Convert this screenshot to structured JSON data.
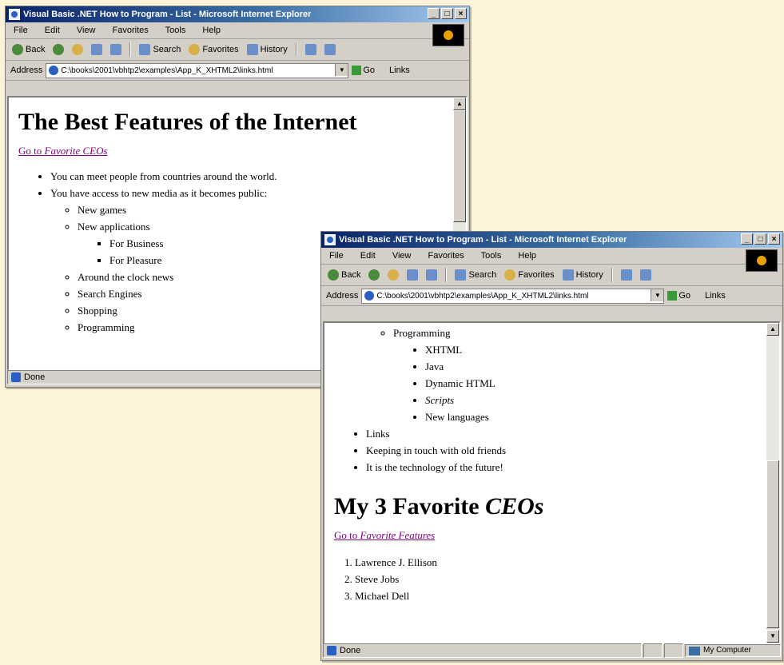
{
  "window1": {
    "title": "Visual Basic .NET How to Program - List - Microsoft Internet Explorer",
    "caption_buttons": [
      "_",
      "□",
      "×"
    ],
    "menu": [
      "File",
      "Edit",
      "View",
      "Favorites",
      "Tools",
      "Help"
    ],
    "toolbar": {
      "back": "Back",
      "search": "Search",
      "favorites": "Favorites",
      "history": "History"
    },
    "address_label": "Address",
    "address_value": "C:\\books\\2001\\vbhtp2\\examples\\App_K_XHTML2\\links.html",
    "go_label": "Go",
    "links_label": "Links",
    "status": "Done",
    "page": {
      "heading": "The Best Features of the Internet",
      "link_prefix": "Go to ",
      "link_em": "Favorite CEOs",
      "items": [
        "You can meet people from countries around the world.",
        "You have access to new media as it becomes public:"
      ],
      "sub_items": [
        "New games",
        "New applications"
      ],
      "sub_sub_items": [
        "For Business",
        "For Pleasure"
      ],
      "sub_items_after": [
        "Around the clock news",
        "Search Engines",
        "Shopping",
        "Programming"
      ]
    }
  },
  "window2": {
    "title": "Visual Basic .NET How to Program - List - Microsoft Internet Explorer",
    "caption_buttons": [
      "_",
      "□",
      "×"
    ],
    "menu": [
      "File",
      "Edit",
      "View",
      "Favorites",
      "Tools",
      "Help"
    ],
    "toolbar": {
      "back": "Back",
      "search": "Search",
      "favorites": "Favorites",
      "history": "History"
    },
    "address_label": "Address",
    "address_value": "C:\\books\\2001\\vbhtp2\\examples\\App_K_XHTML2\\links.html",
    "go_label": "Go",
    "links_label": "Links",
    "status": "Done",
    "zone": "My Computer",
    "page": {
      "programming_item": "Programming",
      "programming_sub": [
        "XHTML",
        "Java",
        "Dynamic HTML",
        "Scripts",
        "New languages"
      ],
      "top_items": [
        "Links",
        "Keeping in touch with old friends",
        "It is the technology of the future!"
      ],
      "heading_prefix": "My 3 Favorite ",
      "heading_em": "CEOs",
      "link_prefix": "Go to ",
      "link_em": "Favorite Features",
      "ceos": [
        "Lawrence J. Ellison",
        "Steve Jobs",
        "Michael Dell"
      ]
    }
  }
}
